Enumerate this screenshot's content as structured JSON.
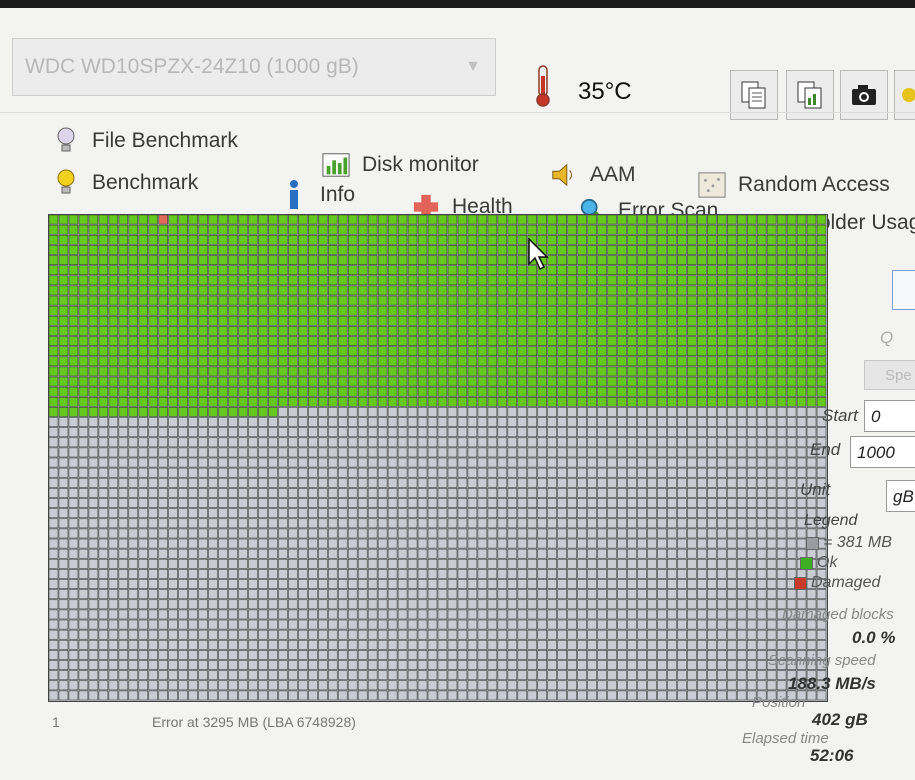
{
  "header": {
    "drive": "WDC WD10SPZX-24Z10 (1000 gB)",
    "temperature": "35°C"
  },
  "tabs_row1": [
    {
      "label": "File Benchmark",
      "icon": "file-benchmark-icon"
    },
    {
      "label": "Disk monitor",
      "icon": "disk-monitor-icon"
    },
    {
      "label": "AAM",
      "icon": "speaker-icon"
    },
    {
      "label": "Random Access",
      "icon": "random-access-icon"
    }
  ],
  "tabs_row2": [
    {
      "label": "Benchmark",
      "icon": "benchmark-icon"
    },
    {
      "label": "Info",
      "icon": "info-icon"
    },
    {
      "label": "Health",
      "icon": "health-cross-icon"
    },
    {
      "label": "Error Scan",
      "icon": "magnifier-icon"
    },
    {
      "label": "Folder Usage",
      "icon": "folder-icon"
    }
  ],
  "scan": {
    "progress_fraction": 0.402,
    "damaged_block_index": 11,
    "ok_color": "#64c81e",
    "pending_color": "#c9ccd2",
    "damaged_color": "#e06a5a"
  },
  "panel": {
    "start_label": "Start",
    "start_value": "0",
    "end_label": "End",
    "end_value": "1000",
    "unit_label": "Unit",
    "unit_value": "gB",
    "legend_title": "Legend",
    "legend_block": "= 381 MB",
    "legend_ok": "Ok",
    "legend_damaged": "Damaged",
    "damaged_blocks_label": "Damaged blocks",
    "damaged_blocks_value": "0.0 %",
    "scanning_speed_label": "Scanning speed",
    "scanning_speed_value": "188.3 MB/s",
    "position_label": "Position",
    "position_value": "402 gB",
    "elapsed_label": "Elapsed time",
    "elapsed_value": "52:06",
    "quick_partial": "Q",
    "speed_partial": "Spe"
  },
  "status": {
    "index": "1",
    "message": "Error at 3295 MB (LBA 6748928)"
  }
}
